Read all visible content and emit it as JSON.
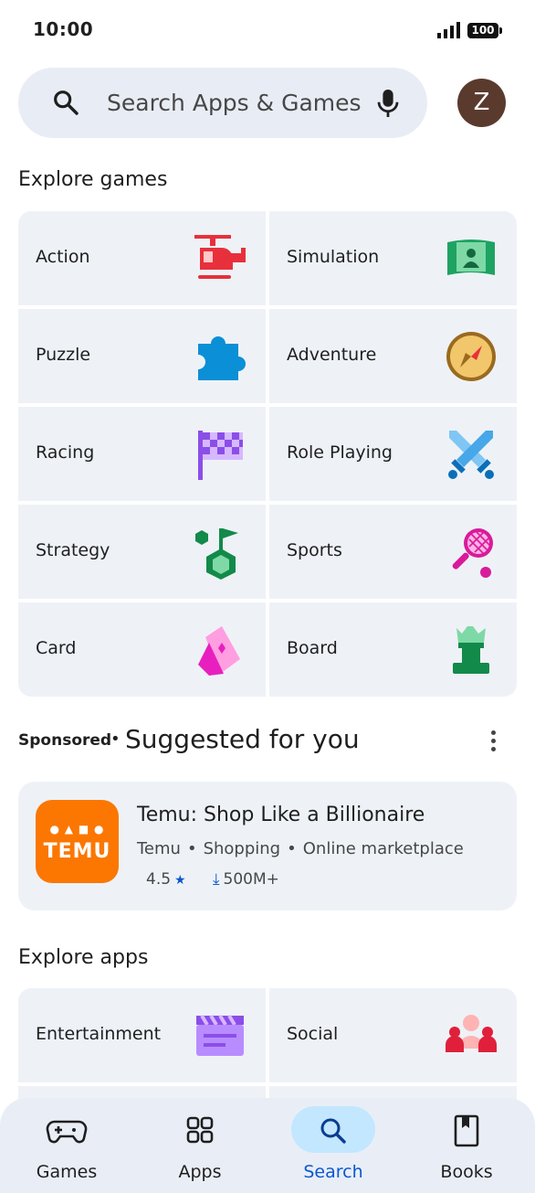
{
  "status_bar": {
    "time": "10:00",
    "battery": "100"
  },
  "search": {
    "placeholder": "Search Apps & Games",
    "avatar_letter": "Z"
  },
  "explore_games": {
    "title": "Explore games",
    "categories": [
      {
        "label": "Action",
        "icon": "helicopter-icon"
      },
      {
        "label": "Simulation",
        "icon": "simulation-icon"
      },
      {
        "label": "Puzzle",
        "icon": "puzzle-piece-icon"
      },
      {
        "label": "Adventure",
        "icon": "compass-icon"
      },
      {
        "label": "Racing",
        "icon": "checkered-flag-icon"
      },
      {
        "label": "Role Playing",
        "icon": "crossed-swords-icon"
      },
      {
        "label": "Strategy",
        "icon": "strategy-icon"
      },
      {
        "label": "Sports",
        "icon": "tennis-racket-icon"
      },
      {
        "label": "Card",
        "icon": "playing-cards-icon"
      },
      {
        "label": "Board",
        "icon": "chess-piece-icon"
      }
    ]
  },
  "sponsored": {
    "label": "Sponsored",
    "separator": "•",
    "title": "Suggested for you",
    "app": {
      "icon_text": "TEMU",
      "name": "Temu: Shop Like a Billionaire",
      "developer": "Temu",
      "category": "Shopping",
      "tag": "Online marketplace",
      "rating": "4.5",
      "downloads": "500M+"
    }
  },
  "explore_apps": {
    "title": "Explore apps",
    "categories": [
      {
        "label": "Entertainment",
        "icon": "clapperboard-icon"
      },
      {
        "label": "Social",
        "icon": "people-icon"
      }
    ]
  },
  "bottom_nav": [
    {
      "label": "Games",
      "icon": "gamepad-icon"
    },
    {
      "label": "Apps",
      "icon": "apps-grid-icon"
    },
    {
      "label": "Search",
      "icon": "search-icon",
      "active": true
    },
    {
      "label": "Books",
      "icon": "book-icon"
    }
  ],
  "colors": {
    "accent": "#0b57d0",
    "tile": "#eef2f7",
    "temu": "#fb7701",
    "active_pill": "#c2e7ff"
  }
}
